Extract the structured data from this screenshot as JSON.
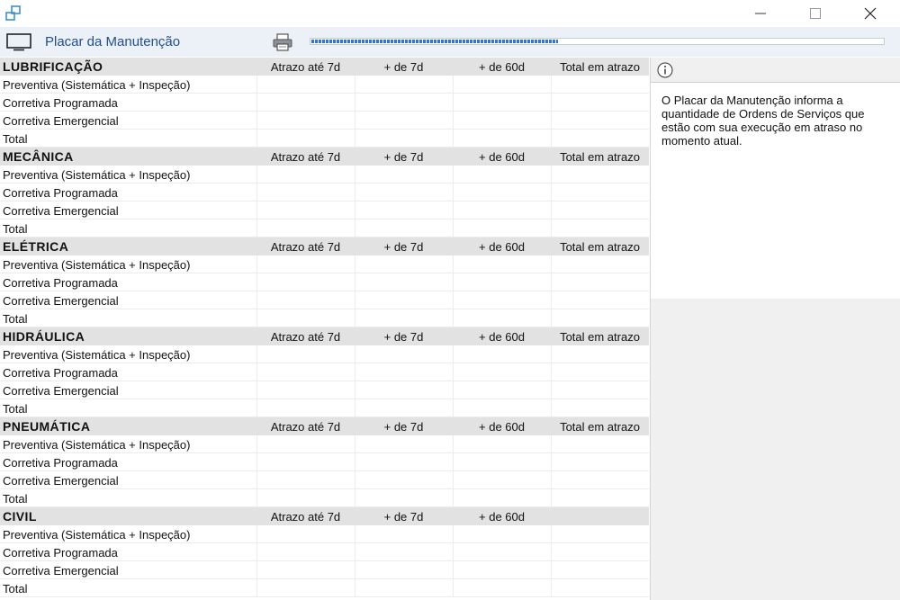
{
  "window": {
    "minimize_icon": "minimize-icon",
    "maximize_icon": "maximize-icon",
    "close_icon": "close-icon"
  },
  "toolbar": {
    "title": "Placar da Manutenção",
    "progress_fraction": 0.43,
    "accent_color": "#1f4f91"
  },
  "columns": [
    "Atrazo até 7d",
    "+ de 7d",
    "+ de 60d",
    "Total em atrazo"
  ],
  "rows": [
    "Preventiva (Sistemática + Inspeção)",
    "Corretiva Programada",
    "Corretiva Emergencial",
    "Total"
  ],
  "sections": [
    {
      "title": "LUBRIFICAÇÃO",
      "columns": [
        "Atrazo até 7d",
        "+ de 7d",
        "+ de 60d",
        "Total em atrazo"
      ]
    },
    {
      "title": "MECÂNICA",
      "columns": [
        "Atrazo até 7d",
        "+ de 7d",
        "+ de 60d",
        "Total em atrazo"
      ]
    },
    {
      "title": "ELÉTRICA",
      "columns": [
        "Atrazo até 7d",
        "+ de 7d",
        "+ de 60d",
        "Total em atrazo"
      ]
    },
    {
      "title": "HIDRÁULICA",
      "columns": [
        "Atrazo até 7d",
        "+ de 7d",
        "+ de 60d",
        "Total em atrazo"
      ]
    },
    {
      "title": "PNEUMÁTICA",
      "columns": [
        "Atrazo até 7d",
        "+ de 7d",
        "+ de 60d",
        "Total em atrazo"
      ]
    },
    {
      "title": "CIVIL",
      "columns": [
        "Atrazo até 7d",
        "+ de 7d",
        "+ de 60d",
        ""
      ]
    }
  ],
  "info": {
    "icon": "info-icon",
    "text": "O Placar da Manutenção informa a quantidade de Ordens de Serviços que estão com sua execução em atraso no momento atual."
  }
}
